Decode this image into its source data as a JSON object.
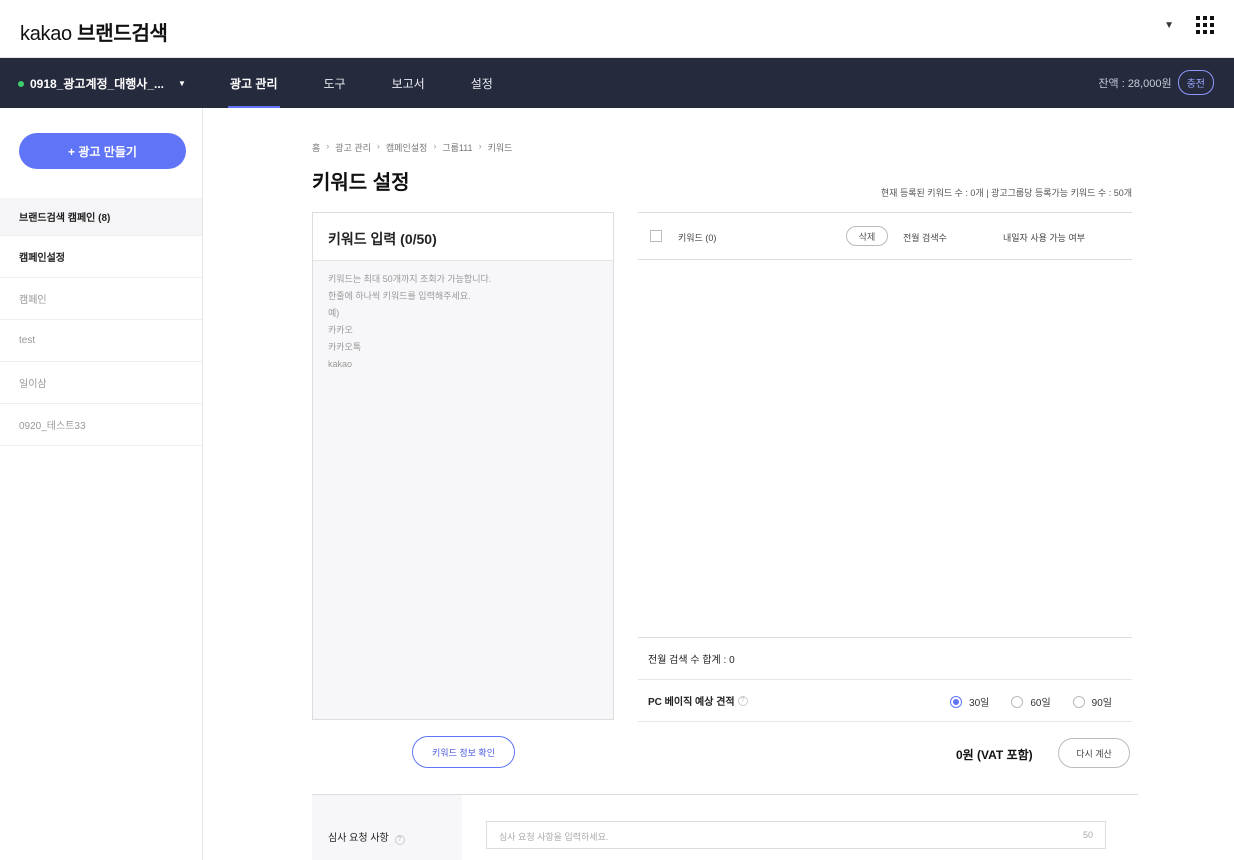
{
  "topbar": {
    "logo_prefix": "kakao",
    "logo_suffix": "브랜드검색"
  },
  "nav": {
    "account": "0918_광고계정_대행사_...",
    "items": [
      "광고 관리",
      "도구",
      "보고서",
      "설정"
    ],
    "balance": "잔액 : 28,000원",
    "charge": "충전"
  },
  "sidebar": {
    "create_button": "+ 광고 만들기",
    "items": [
      "브랜드검색 캠페인 (8)",
      "캠페인설정",
      "캠페인",
      "test",
      "일이삼",
      "0920_테스트33"
    ]
  },
  "breadcrumb": [
    "홈",
    "광고 관리",
    "캠페인설정",
    "그룹111",
    "키워드"
  ],
  "page_title": "키워드 설정",
  "keyword_counts": "현재 등록된 키워드 수 : 0개  |  광고그룹당 등록가능 키워드 수 : 50개",
  "input_panel": {
    "title": "키워드 입력 (0/50)",
    "hint_lines": [
      "키워드는 최대 50개까지 조회가 가능합니다.",
      "한줄에 하나씩 키워드를 입력해주세요.",
      "예)",
      "카카오",
      "카카오톡",
      "kakao"
    ]
  },
  "table": {
    "col_keyword": "키워드 (0)",
    "delete": "삭제",
    "col_search": "전월 검색수",
    "col_available": "내일자 사용 가능 여부"
  },
  "summary": {
    "search_total": "전월 검색 수 합계 : 0",
    "estimate_label": "PC 베이직 예상 견적",
    "help": "?",
    "periods": [
      "30일",
      "60일",
      "90일"
    ],
    "selected_period": "30일"
  },
  "actions": {
    "confirm": "키워드 정보 확인",
    "total": "0원 (VAT 포함)",
    "recalc": "다시 계산"
  },
  "review": {
    "label": "심사 요청 사항",
    "placeholder": "심사 요청 사항을 입력하세요.",
    "limit": "50"
  }
}
